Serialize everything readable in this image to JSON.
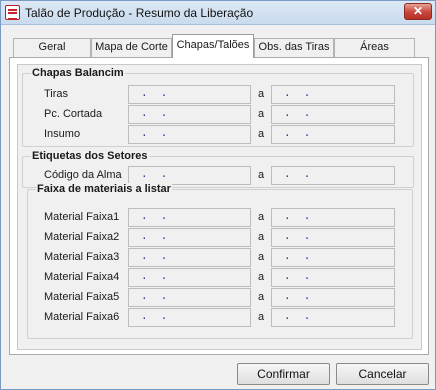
{
  "window": {
    "title": "Talão de Produção - Resumo da Liberação",
    "close_glyph": "✕",
    "icon": "app-icon"
  },
  "tabs": [
    {
      "label": "Geral",
      "active": false
    },
    {
      "label": "Mapa de Corte",
      "active": false
    },
    {
      "label": "Chapas/Talões",
      "active": true
    },
    {
      "label": "Obs. das Tiras",
      "active": false
    },
    {
      "label": "Áreas",
      "active": false
    }
  ],
  "range_separator": "a",
  "empty_value": ".  .",
  "groups": {
    "chapas": {
      "title": "Chapas Balancim",
      "rows": [
        {
          "label": "Tiras",
          "from": ".  .",
          "to": ".  ."
        },
        {
          "label": "Pc. Cortada",
          "from": ".  .",
          "to": ".  ."
        },
        {
          "label": "Insumo",
          "from": ".  .",
          "to": ".  ."
        }
      ]
    },
    "etiquetas": {
      "title": "Etiquetas dos Setores",
      "rows": [
        {
          "label": "Código da Alma",
          "from": ".  .",
          "to": ".  ."
        }
      ]
    },
    "faixa": {
      "title": "Faixa de materiais a listar",
      "rows": [
        {
          "label": "Material Faixa1",
          "from": ".  .",
          "to": ".  ."
        },
        {
          "label": "Material Faixa2",
          "from": ".  .",
          "to": ".  ."
        },
        {
          "label": "Material Faixa3",
          "from": ".  .",
          "to": ".  ."
        },
        {
          "label": "Material Faixa4",
          "from": ".  .",
          "to": ".  ."
        },
        {
          "label": "Material Faixa5",
          "from": ".  .",
          "to": ".  ."
        },
        {
          "label": "Material Faixa6",
          "from": ".  .",
          "to": ".  ."
        }
      ]
    }
  },
  "buttons": {
    "confirm": "Confirmar",
    "cancel": "Cancelar"
  }
}
